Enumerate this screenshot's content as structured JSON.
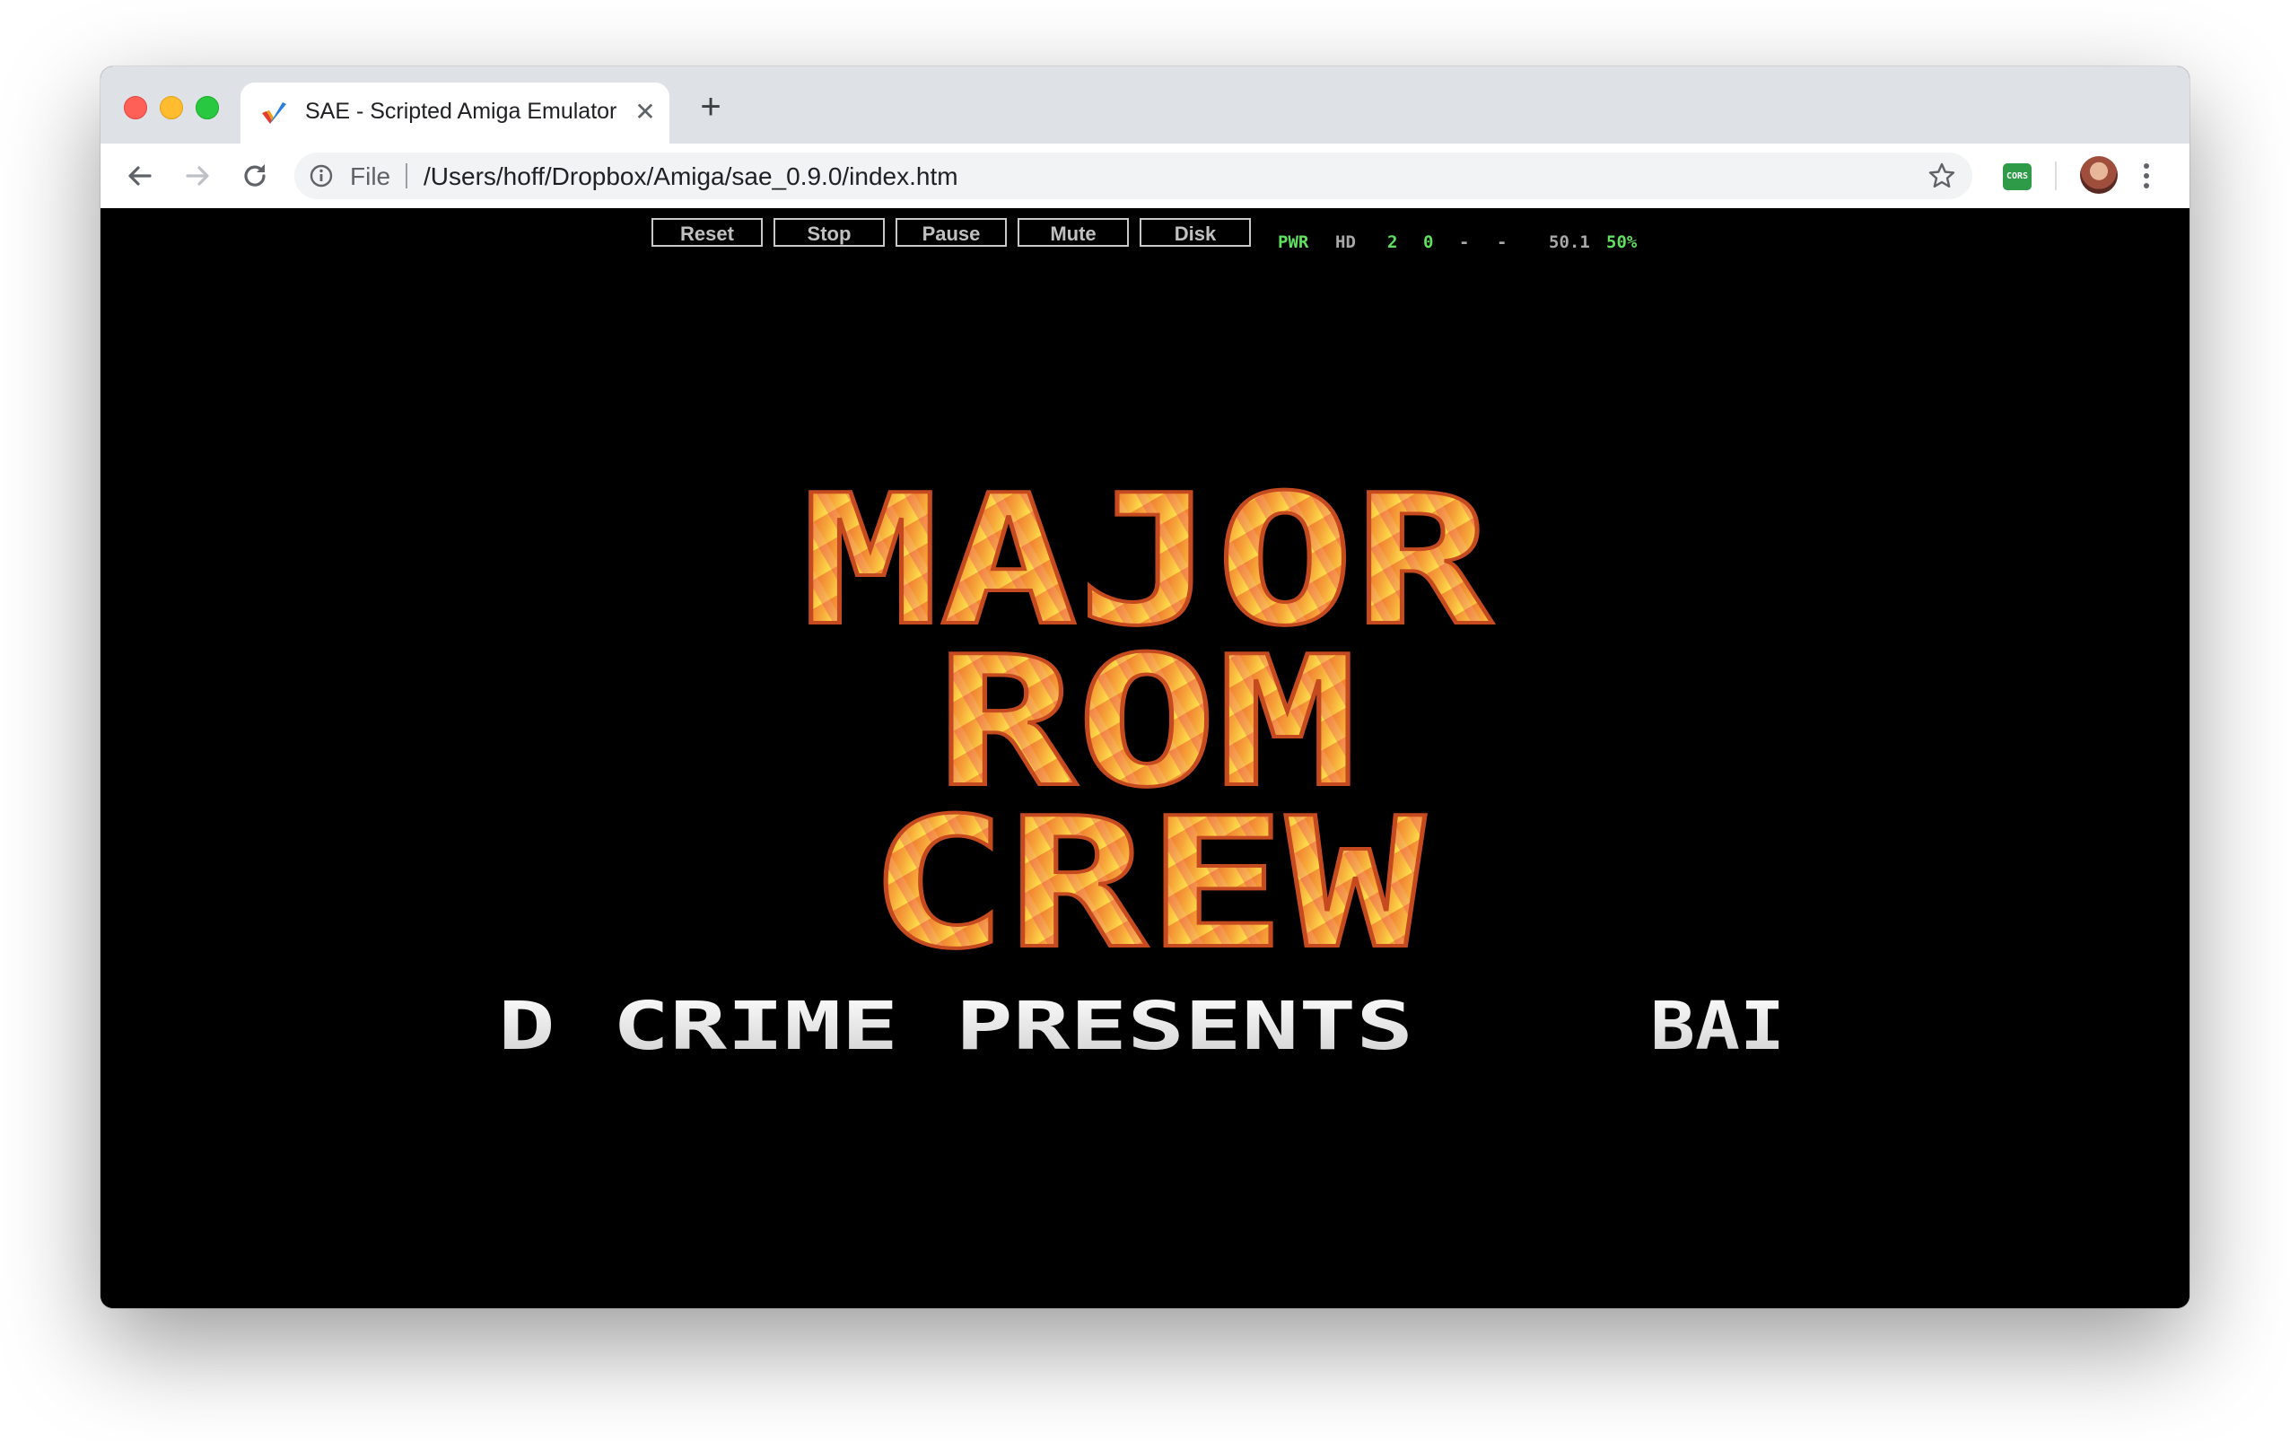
{
  "browser": {
    "tab": {
      "title": "SAE - Scripted Amiga Emulator"
    },
    "address": {
      "scheme": "File",
      "url": "/Users/hoff/Dropbox/Amiga/sae_0.9.0/index.htm"
    },
    "extension": {
      "label": "CORS"
    }
  },
  "emulator": {
    "buttons": [
      {
        "label": "Reset"
      },
      {
        "label": "Stop"
      },
      {
        "label": "Pause"
      },
      {
        "label": "Mute"
      },
      {
        "label": "Disk"
      }
    ],
    "status": {
      "power": "PWR",
      "hd": "HD",
      "drive0": "2",
      "drive1": "0",
      "drive2": "-",
      "drive3": "-",
      "fps": "50.1",
      "speed": "50%"
    },
    "display": {
      "logo_lines": [
        "MAJOR",
        "ROM",
        "CREW"
      ],
      "credit_line": "D CRIME PRESENTS",
      "credit_tag": "BAI"
    },
    "colors": {
      "status_green": "#5fe05f",
      "status_grey": "#a8a8a8",
      "logo_top": "#ef6a2e",
      "logo_bottom": "#ffe44d"
    }
  }
}
